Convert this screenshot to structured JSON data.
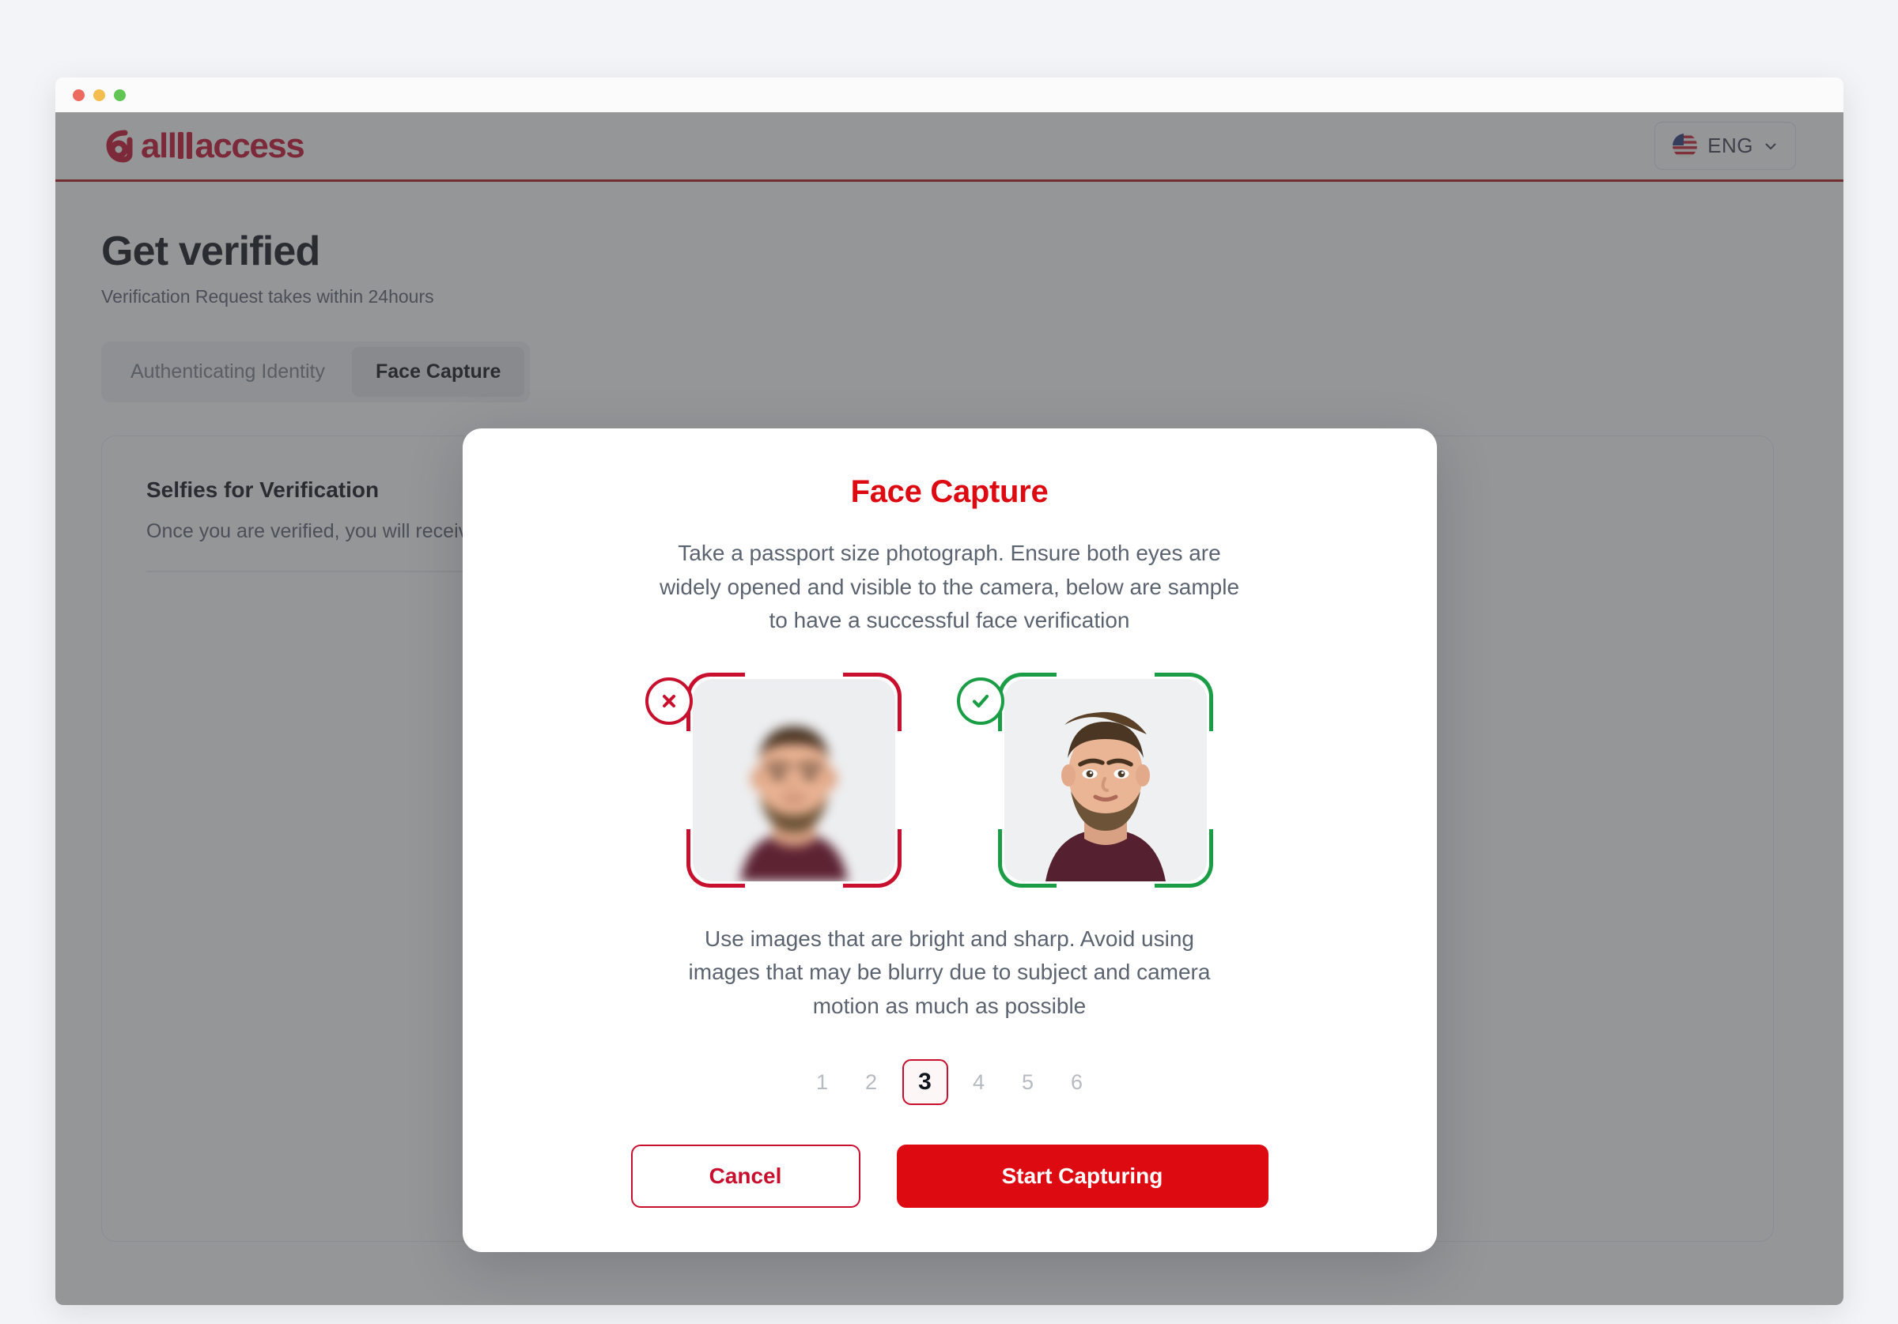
{
  "window": {
    "traffic_lights": [
      "close",
      "minimize",
      "maximize"
    ]
  },
  "appbar": {
    "logo_text": "all access",
    "logo_icon": "allaccess-a-mark-icon",
    "language": {
      "flag_icon": "us-flag-icon",
      "label": "ENG",
      "chevron_icon": "chevron-down-icon"
    }
  },
  "page": {
    "title": "Get verified",
    "subtitle": "Verification Request takes within 24hours",
    "tabs": [
      {
        "label": "Authenticating Identity",
        "active": false
      },
      {
        "label": "Face Capture",
        "active": true
      }
    ],
    "card": {
      "title": "Selfies for Verification",
      "description": "Once you are verified, you will receive a badge"
    },
    "camera_controls": {
      "left_icon": "gallery-icon",
      "capture_icon": "face-scan-icon",
      "right_icon": "card-icon"
    }
  },
  "modal": {
    "title": "Face Capture",
    "intro": "Take a passport size photograph. Ensure both eyes are widely opened and visible to the camera, below are sample to have a successful face verification",
    "note": "Use images that are bright and sharp. Avoid using images that may be blurry due to subject and camera motion as much as possible",
    "samples": [
      {
        "status": "bad",
        "badge_icon": "circle-x-icon",
        "frame_color": "#c8102e",
        "image_alt": "blurry-portrait-photo"
      },
      {
        "status": "good",
        "badge_icon": "circle-check-icon",
        "frame_color": "#1a9d45",
        "image_alt": "sharp-portrait-photo"
      }
    ],
    "pagination": {
      "pages": [
        "1",
        "2",
        "3",
        "4",
        "5",
        "6"
      ],
      "current": "3"
    },
    "buttons": {
      "cancel": "Cancel",
      "primary": "Start Capturing"
    }
  },
  "colors": {
    "brand_red": "#c8102e",
    "button_red": "#dd0a11",
    "success_green": "#1a9d45"
  }
}
